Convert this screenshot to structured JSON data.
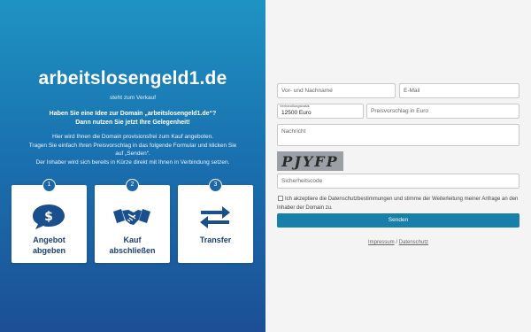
{
  "left": {
    "domain": "arbeitslosengeld1.de",
    "subtitle": "steht zum Verkauf",
    "question_line1": "Haben Sie eine Idee zur Domain „arbeitslosengeld1.de“?",
    "question_line2": "Dann nutzen Sie jetzt Ihre Gelegenheit!",
    "desc_line1": "Hier wird Ihnen die Domain provisionsfrei zum Kauf angeboten.",
    "desc_line2": "Tragen Sie einfach Ihren Preisvorschlag in das folgende Formular und klicken Sie",
    "desc_line3": "auf „Senden“.",
    "desc_line4": "Der Inhaber wird sich bereits in Kürze direkt mit Ihnen in Verbindung setzen.",
    "steps": [
      {
        "num": "1",
        "label1": "Angebot",
        "label2": "abgeben",
        "icon": "dollar-speech-bubble-icon"
      },
      {
        "num": "2",
        "label1": "Kauf",
        "label2": "abschließen",
        "icon": "handshake-icon"
      },
      {
        "num": "3",
        "label1": "Transfer",
        "label2": "",
        "icon": "transfer-arrows-icon"
      }
    ]
  },
  "form": {
    "name_placeholder": "Vor- und Nachname",
    "email_placeholder": "E-Mail",
    "asking_price_caption": "Verhandlungsbasis",
    "asking_price_value": "12500 Euro",
    "offer_placeholder": "Preisvorschlag in Euro",
    "message_placeholder": "Nachricht",
    "captcha_text": "PJYFP",
    "security_placeholder": "Sicherheitscode",
    "consent_text": "Ich akzeptiere die Datenschutzbestimmungen und stimme der Weiterleitung meiner Anfrage an den Inhaber der Domain zu.",
    "submit_label": "Senden"
  },
  "footer": {
    "impressum": "Impressum",
    "separator": "/",
    "datenschutz": "Datenschutz"
  }
}
